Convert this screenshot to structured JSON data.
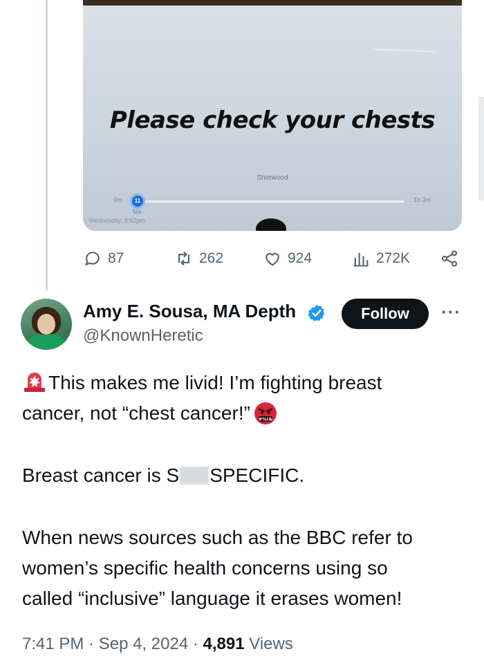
{
  "media": {
    "caption": "Please check your chests",
    "source": "Sherwood",
    "time_start": "0m",
    "time_end": "1h 3m",
    "knob_label": "11",
    "knob_sub": "50s",
    "date_overlay": "Wednesday, 8:52pm"
  },
  "actions": {
    "replies": "87",
    "reposts": "262",
    "likes": "924",
    "views": "272K"
  },
  "author": {
    "name": "Amy E. Sousa, MA Depth",
    "handle": "@KnownHeretic",
    "follow_label": "Follow",
    "more_label": "···"
  },
  "tweet": {
    "line1": "This makes me livid! I’m fighting breast",
    "line2": "cancer, not “chest cancer!”",
    "line3_a": "Breast cancer is S",
    "line3_b": "SPECIFIC.",
    "line4": "When news sources such as the BBC refer to",
    "line5": "women’s specific health concerns using so",
    "line6": "called “inclusive” language it erases women!",
    "angry_text": "#%!&"
  },
  "meta": {
    "time": "7:41 PM",
    "date": "Sep 4, 2024",
    "views_count": "4,891",
    "views_label": "Views",
    "separator": "·"
  },
  "colors": {
    "text": "#0f1419",
    "secondary": "#536471",
    "verified": "#1d9bf0",
    "follow_bg": "#0f1419"
  }
}
